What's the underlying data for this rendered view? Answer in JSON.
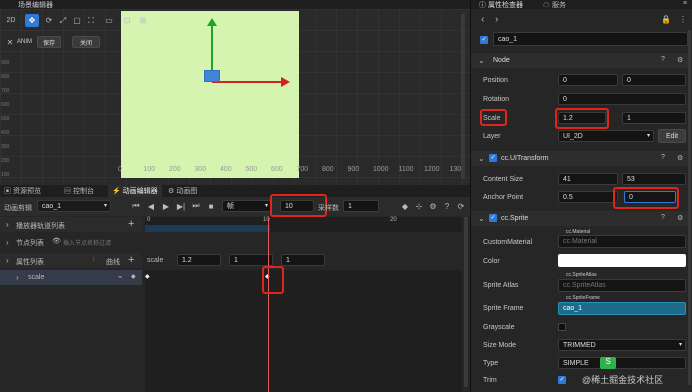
{
  "scene": {
    "title": "场景编辑器",
    "toolbar": [
      "2D"
    ],
    "anim_label": "ANIM",
    "save": "保存",
    "close": "关闭",
    "ruler_x": [
      "0",
      "100",
      "200",
      "300",
      "400",
      "500",
      "600",
      "700",
      "800",
      "900",
      "1000",
      "1100",
      "1200",
      "1300"
    ],
    "ruler_y": [
      "900",
      "800",
      "700",
      "600",
      "500",
      "400",
      "300",
      "200",
      "100",
      "0"
    ]
  },
  "tabs": [
    {
      "label": "资源预览"
    },
    {
      "label": "控制台"
    },
    {
      "label": "动画编辑器"
    },
    {
      "label": "动画图"
    }
  ],
  "anim": {
    "clip_label": "动画剪辑",
    "clip_value": "cao_1",
    "frame_mode": "帧",
    "frame_value": "10",
    "sample_label": "采样数",
    "sample_value": "1",
    "player_track": "播放器轨道列表",
    "node_list": "节点列表",
    "node_placeholder": "插入节点名称过滤",
    "prop_list": "属性列表",
    "curve_label": "曲线",
    "prop_name": "scale",
    "scale_label": "scale",
    "scale_x": "1.2",
    "scale_y": "1",
    "scale_z": "1",
    "ruler_marks": [
      "0",
      "10",
      "20"
    ]
  },
  "inspector": {
    "title": "属性检查器",
    "tab2": "服务",
    "node_name": "cao_1",
    "node_section": "Node",
    "position_label": "Position",
    "position_x": "0",
    "position_y": "0",
    "rotation_label": "Rotation",
    "rotation_value": "0",
    "scale_label": "Scale",
    "scale_x": "1.2",
    "scale_y": "1",
    "layer_label": "Layer",
    "layer_value": "UI_2D",
    "edit_label": "Edit",
    "uitransform": "cc.UITransform",
    "content_size_label": "Content Size",
    "cs_w": "41",
    "cs_h": "53",
    "anchor_label": "Anchor Point",
    "anchor_x": "0.5",
    "anchor_y": "0",
    "sprite": "cc.Sprite",
    "custom_material_label": "CustomMaterial",
    "cm_type": "cc.Material",
    "cm_value": "cc.Material",
    "color_label": "Color",
    "atlas_label": "Sprite Atlas",
    "atlas_type": "cc.SpriteAtlas",
    "atlas_value": "cc.SpriteAtlas",
    "frame_label": "Sprite Frame",
    "frame_type": "cc.SpriteFrame",
    "frame_value": "cao_1",
    "grayscale_label": "Grayscale",
    "sizemode_label": "Size Mode",
    "sizemode_value": "TRIMMED",
    "type_label": "Type",
    "type_value": "SIMPLE",
    "trim_label": "Trim"
  },
  "watermark": "@稀土掘金技术社区",
  "colors": {
    "accent": "#2f7ad6",
    "red": "#e0251d",
    "canvas": "#d4f4b0",
    "frame_field": "#1d6b8a"
  }
}
